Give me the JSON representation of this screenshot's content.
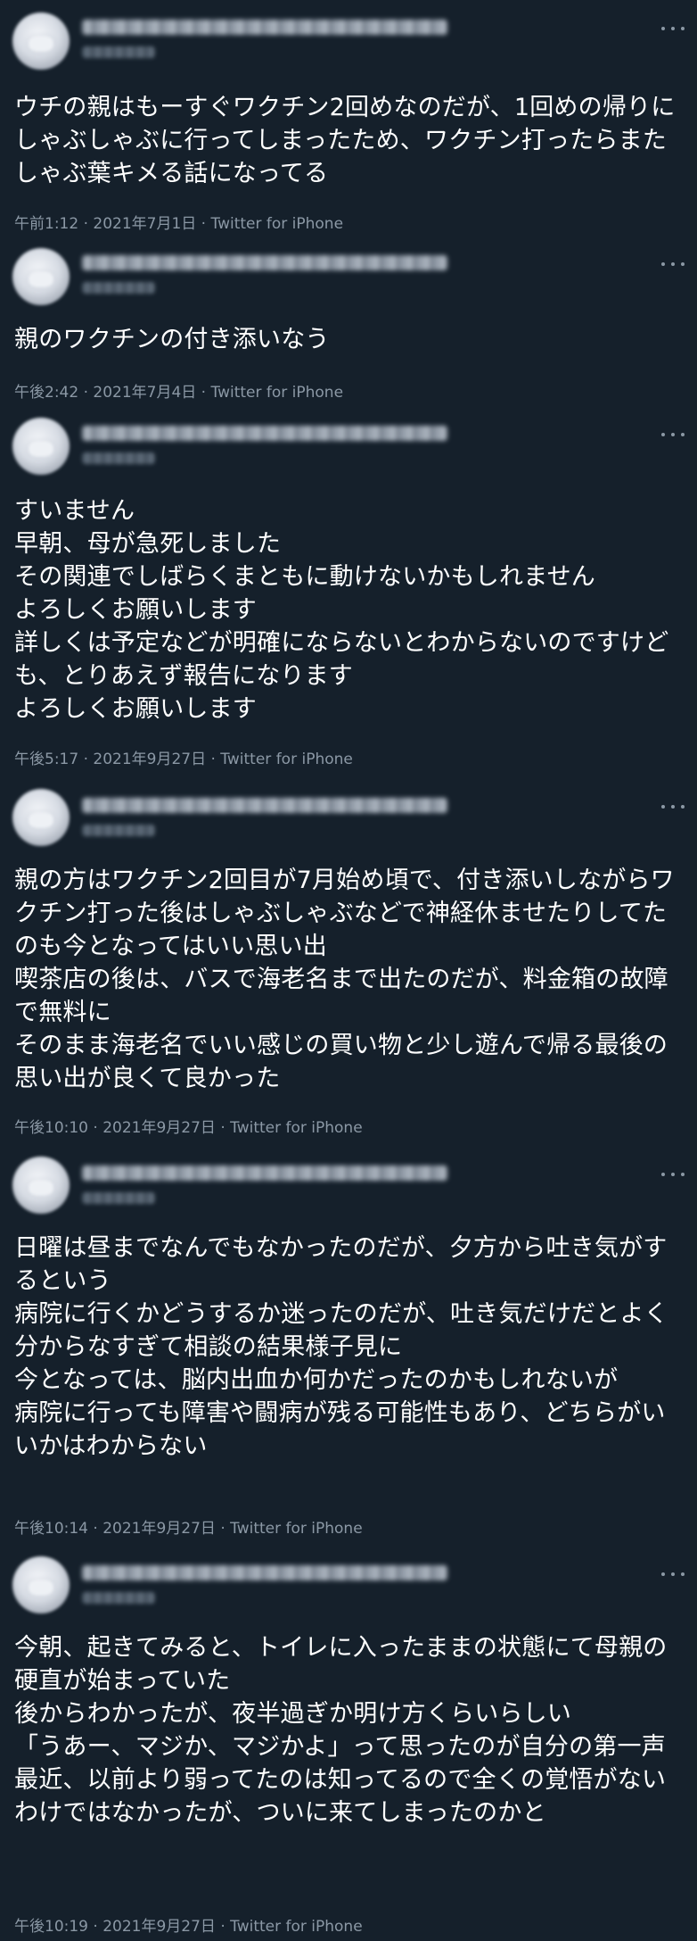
{
  "tweets": [
    {
      "text": "ウチの親はもーすぐワクチン2回めなのだが、1回めの帰りにしゃぶしゃぶに行ってしまったため、ワクチン打ったらまたしゃぶ葉キメる話になってる",
      "meta": "午前1:12 · 2021年7月1日 · Twitter for iPhone"
    },
    {
      "text": "親のワクチンの付き添いなう",
      "meta": "午後2:42 · 2021年7月4日 · Twitter for iPhone"
    },
    {
      "text": "すいません\n早朝、母が急死しました\nその関連でしばらくまともに動けないかもしれません\nよろしくお願いします\n詳しくは予定などが明確にならないとわからないのですけども、とりあえず報告になります\nよろしくお願いします",
      "meta": "午後5:17 · 2021年9月27日 · Twitter for iPhone"
    },
    {
      "text": "親の方はワクチン2回目が7月始め頃で、付き添いしながらワクチン打った後はしゃぶしゃぶなどで神経休ませたりしてたのも今となってはいい思い出\n喫茶店の後は、バスで海老名まで出たのだが、料金箱の故障で無料に\nそのまま海老名でいい感じの買い物と少し遊んで帰る最後の思い出が良くて良かった",
      "meta": "午後10:10 · 2021年9月27日 · Twitter for iPhone"
    },
    {
      "text": "日曜は昼までなんでもなかったのだが、夕方から吐き気がするという\n病院に行くかどうするか迷ったのだが、吐き気だけだとよく分からなすぎて相談の結果様子見に\n今となっては、脳内出血か何かだったのかもしれないが\n病院に行っても障害や闘病が残る可能性もあり、どちらがいいかはわからない",
      "meta": "午後10:14 · 2021年9月27日 · Twitter for iPhone"
    },
    {
      "text": "今朝、起きてみると、トイレに入ったままの状態にて母親の硬直が始まっていた\n後からわかったが、夜半過ぎか明け方くらいらしい\n「うあー、マジか、マジかよ」って思ったのが自分の第一声\n最近、以前より弱ってたのは知ってるので全くの覚悟がないわけではなかったが、ついに来てしまったのかと",
      "meta": "午後10:19 · 2021年9月27日 · Twitter for iPhone"
    }
  ],
  "icons": {
    "more": "more-horizontal-icon",
    "avatar": "avatar-blurred"
  },
  "colors": {
    "background": "#15202b",
    "text": "#ffffff",
    "secondary": "#8b98a5"
  }
}
